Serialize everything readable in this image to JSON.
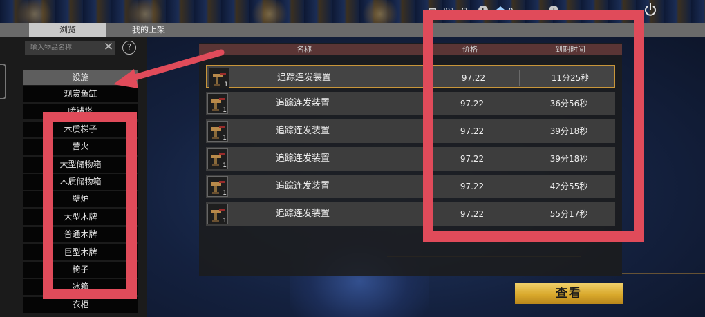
{
  "currency": {
    "gold_amount": "391.71",
    "gem_amount": "0",
    "add_label": "+"
  },
  "tabs": [
    {
      "label": "浏览"
    },
    {
      "label": "我的上架"
    }
  ],
  "search": {
    "placeholder": "输入物品名称",
    "clear_label": "✕",
    "help_label": "?"
  },
  "category": {
    "header": "设施",
    "items": [
      "观赏鱼缸",
      "喷错塔",
      "木质梯子",
      "营火",
      "大型储物箱",
      "木质储物箱",
      "壁炉",
      "大型木牌",
      "普通木牌",
      "巨型木牌",
      "椅子",
      "冰箱",
      "衣柜"
    ]
  },
  "columns": {
    "name": "名称",
    "price": "价格",
    "expire": "到期时间"
  },
  "listings": [
    {
      "name": "追踪连发装置",
      "qty": "1",
      "price": "97.22",
      "expire": "11分25秒",
      "selected": true
    },
    {
      "name": "追踪连发装置",
      "qty": "1",
      "price": "97.22",
      "expire": "36分56秒",
      "selected": false
    },
    {
      "name": "追踪连发装置",
      "qty": "1",
      "price": "97.22",
      "expire": "39分18秒",
      "selected": false
    },
    {
      "name": "追踪连发装置",
      "qty": "1",
      "price": "97.22",
      "expire": "39分18秒",
      "selected": false
    },
    {
      "name": "追踪连发装置",
      "qty": "1",
      "price": "97.22",
      "expire": "42分55秒",
      "selected": false
    },
    {
      "name": "追踪连发装置",
      "qty": "1",
      "price": "97.22",
      "expire": "55分17秒",
      "selected": false
    }
  ],
  "view_button": "查看",
  "colors": {
    "annotation": "#e04b5a",
    "selected_border": "#c9963a",
    "button_gold": "#e0b23a"
  },
  "icons": {
    "gold": "gold-bar-icon",
    "gem": "gem-icon",
    "power": "power-icon",
    "item": "turret-icon"
  }
}
